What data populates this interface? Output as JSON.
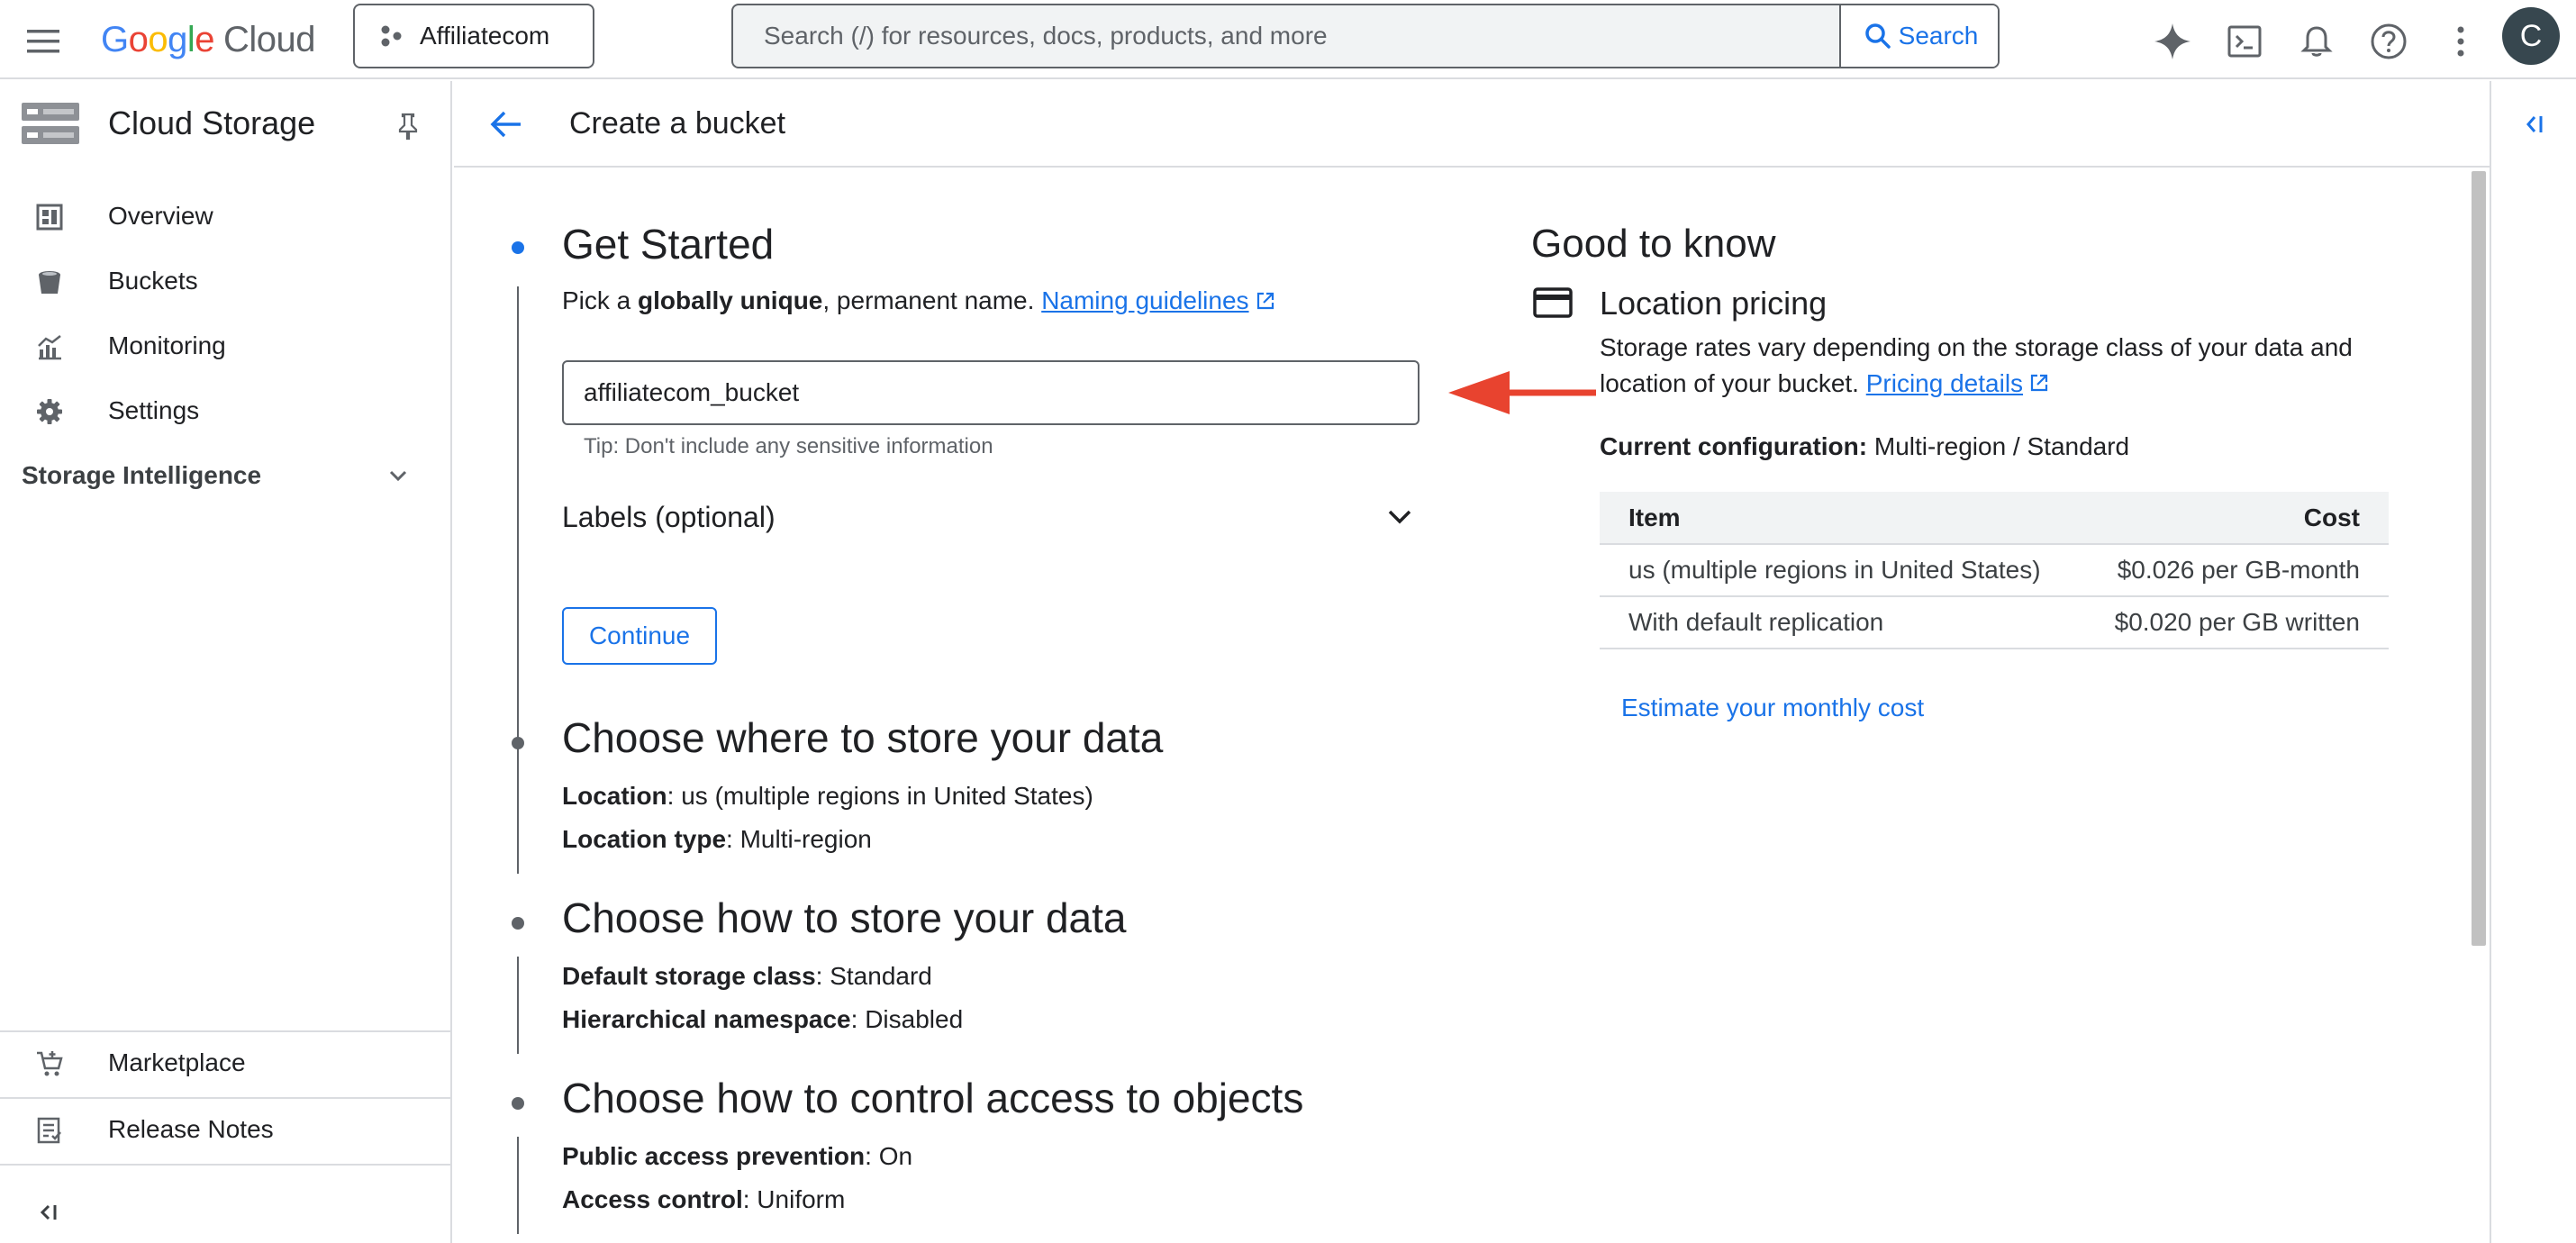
{
  "topbar": {
    "logo_parts": [
      "G",
      "o",
      "o",
      "g",
      "l",
      "e"
    ],
    "logo_suffix": "Cloud",
    "project_name": "Affiliatecom",
    "search_placeholder": "Search (/) for resources, docs, products, and more",
    "search_button_label": "Search",
    "avatar_initial": "C"
  },
  "sidebar": {
    "product_title": "Cloud Storage",
    "items": [
      {
        "label": "Overview",
        "icon": "dashboard-icon"
      },
      {
        "label": "Buckets",
        "icon": "bucket-icon"
      },
      {
        "label": "Monitoring",
        "icon": "monitoring-icon"
      },
      {
        "label": "Settings",
        "icon": "gear-icon"
      }
    ],
    "section_label": "Storage Intelligence",
    "bottom_items": [
      {
        "label": "Marketplace",
        "icon": "cart-icon"
      },
      {
        "label": "Release Notes",
        "icon": "notes-icon"
      }
    ]
  },
  "page": {
    "title": "Create a bucket"
  },
  "steps": {
    "get_started": {
      "title": "Get Started",
      "desc_prefix": "Pick a ",
      "desc_bold": "globally unique",
      "desc_suffix": ", permanent name. ",
      "naming_link": "Naming guidelines",
      "bucket_name_value": "affiliatecom_bucket",
      "tip": "Tip: Don't include any sensitive information",
      "labels_toggle": "Labels (optional)",
      "continue_label": "Continue"
    },
    "location": {
      "title": "Choose where to store your data",
      "line1_key": "Location",
      "line1_value": ": us (multiple regions in United States)",
      "line2_key": "Location type",
      "line2_value": ": Multi-region"
    },
    "storage": {
      "title": "Choose how to store your data",
      "line1_key": "Default storage class",
      "line1_value": ": Standard",
      "line2_key": "Hierarchical namespace",
      "line2_value": ": Disabled"
    },
    "access": {
      "title": "Choose how to control access to objects",
      "line1_key": "Public access prevention",
      "line1_value": ": On",
      "line2_key": "Access control",
      "line2_value": ": Uniform"
    }
  },
  "good_to_know": {
    "title": "Good to know",
    "pricing_title": "Location pricing",
    "pricing_desc": "Storage rates vary depending on the storage class of your data and location of your bucket. ",
    "pricing_link": "Pricing details",
    "config_label": "Current configuration:",
    "config_value": " Multi-region / Standard",
    "table": {
      "headers": [
        "Item",
        "Cost"
      ],
      "rows": [
        [
          "us (multiple regions in United States)",
          "$0.026 per GB-month"
        ],
        [
          "With default replication",
          "$0.020 per GB written"
        ]
      ]
    },
    "estimate_link": "Estimate your monthly cost"
  },
  "colors": {
    "accent": "#1a73e8",
    "annotation_arrow": "#e8432f"
  }
}
